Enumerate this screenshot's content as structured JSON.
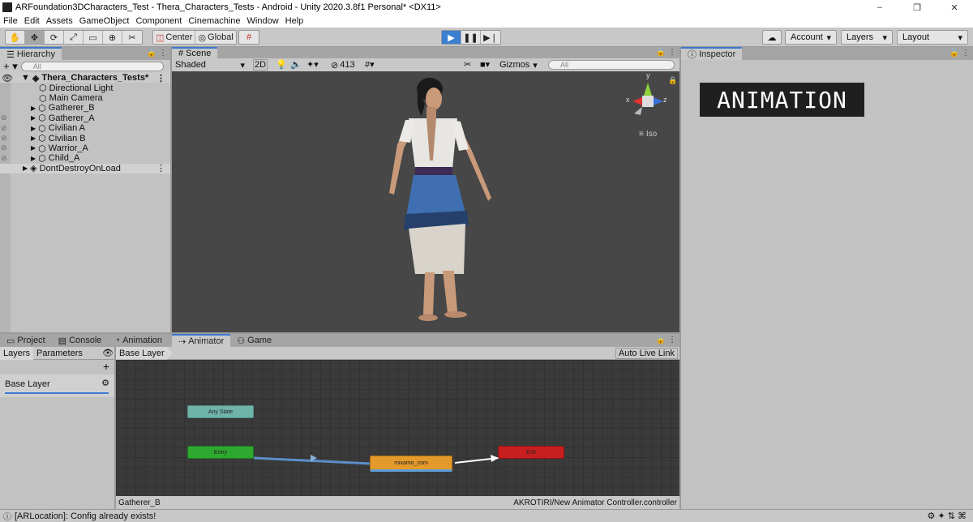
{
  "window": {
    "title": "ARFoundation3DCharacters_Test - Thera_Characters_Tests - Android - Unity 2020.3.8f1 Personal* <DX11>",
    "controls": [
      "–",
      "❐",
      "✕"
    ]
  },
  "menu": [
    "File",
    "Edit",
    "Assets",
    "GameObject",
    "Component",
    "Cinemachine",
    "Window",
    "Help"
  ],
  "toolbar": {
    "center_label": "Center",
    "global_label": "Global",
    "account_label": "Account",
    "layers_label": "Layers",
    "layout_label": "Layout"
  },
  "hierarchy": {
    "tab": "Hierarchy",
    "search_placeholder": "All",
    "scene_name": "Thera_Characters_Tests*",
    "items": [
      {
        "label": "Directional Light"
      },
      {
        "label": "Main Camera"
      },
      {
        "label": "Gatherer_B"
      },
      {
        "label": "Gatherer_A"
      },
      {
        "label": "Civilian A"
      },
      {
        "label": "Civilian B"
      },
      {
        "label": "Warrior_A"
      },
      {
        "label": "Child_A"
      }
    ],
    "dont_destroy": "DontDestroyOnLoad"
  },
  "scene": {
    "tab": "Scene",
    "shading": "Shaded",
    "mode_2d": "2D",
    "hidden_count": "413",
    "gizmos": "Gizmos",
    "search_placeholder": "All",
    "iso_label": "Iso",
    "axis_x": "x",
    "axis_y": "y",
    "axis_z": "z"
  },
  "inspector": {
    "tab": "Inspector",
    "banner": "ANIMATION"
  },
  "bottom_tabs": {
    "project": "Project",
    "console": "Console",
    "animation": "Animation",
    "animator": "Animator",
    "game": "Game"
  },
  "animator": {
    "layers_tab": "Layers",
    "parameters_tab": "Parameters",
    "breadcrumb": "Base Layer",
    "auto_live_link": "Auto Live Link",
    "layer_name": "Base Layer",
    "nodes": {
      "any_state": "Any State",
      "entry": "Entry",
      "state": "mixamo_com",
      "exit": "Exit"
    },
    "footer_left": "Gatherer_B",
    "footer_right": "AKROTIRI/New Animator Controller.controller"
  },
  "status": {
    "message": "[ARLocation]: Config already exists!"
  }
}
